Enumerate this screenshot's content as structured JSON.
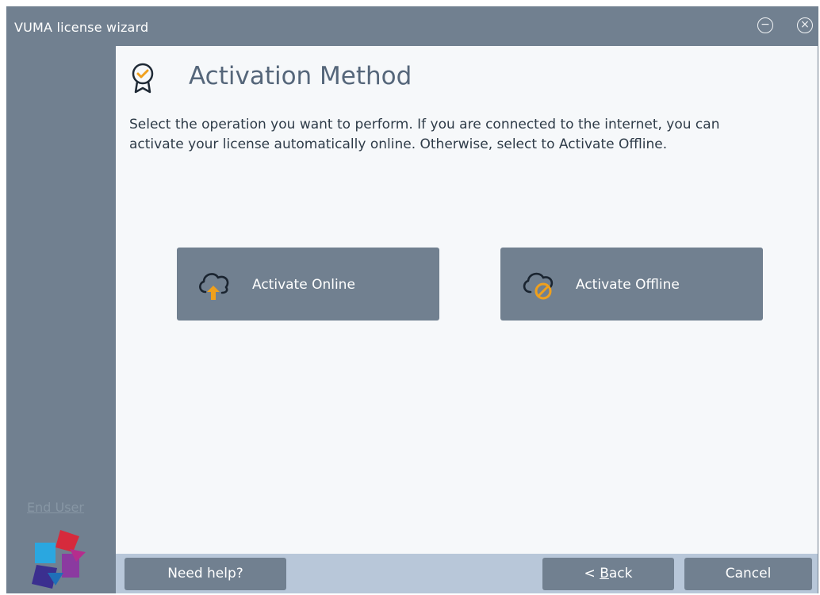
{
  "window": {
    "title": "VUMA license wizard",
    "minimize_glyph": "−",
    "close_glyph": "×"
  },
  "sidebar": {
    "link_label": "End User",
    "logo_icon": "vuma-logo-icon"
  },
  "page": {
    "title": "Activation Method",
    "title_icon": "award-badge-icon",
    "description": "Select the operation you want to perform. If you are connected to the internet, you can activate your license automatically online. Otherwise, select to Activate Offline."
  },
  "actions": {
    "online_label": "Activate Online",
    "online_icon": "cloud-upload-icon",
    "offline_label": "Activate Offline",
    "offline_icon": "cloud-blocked-icon"
  },
  "footer": {
    "help_label": "Need help?",
    "back_prefix": "< ",
    "back_access_key": "B",
    "back_rest": "ack",
    "cancel_label": "Cancel"
  },
  "colors": {
    "chrome": "#718090",
    "content_bg": "#f6f8fa",
    "footer_bg": "#b8c7d9",
    "accent_orange": "#f0a01c",
    "heading_text": "#55667a"
  }
}
